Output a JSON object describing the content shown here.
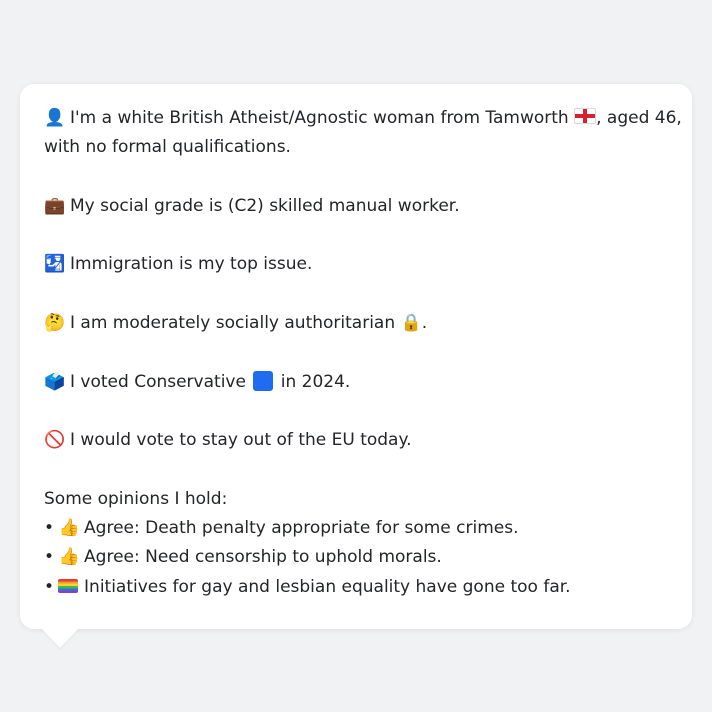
{
  "profile": {
    "line1_icon": "👤",
    "line1_text_a": "I'm a white British Atheist/Agnostic woman from Tamworth ",
    "line1_text_b": ", aged 46,",
    "line2_text": "with no formal qualifications.",
    "social_icon": "💼",
    "social_text": "My social grade is (C2) skilled manual worker.",
    "issue_icon": "🛂",
    "issue_text": "Immigration is my top issue.",
    "stance_icon": "🤔",
    "stance_text": "I am moderately socially authoritarian ",
    "stance_lock_icon": "🔒",
    "stance_end": ".",
    "vote_icon": "🗳️",
    "vote_text_a": "I voted Conservative ",
    "vote_text_b": " in 2024.",
    "eu_icon": "🚫",
    "eu_text": "I would vote to stay out of the EU today."
  },
  "opinions": {
    "heading": "Some opinions I hold:",
    "bullet": "•",
    "items": [
      {
        "icon": "👍",
        "text": "Agree: Death penalty appropriate for some crimes."
      },
      {
        "icon": "👍",
        "text": "Agree: Need censorship to uphold morals."
      },
      {
        "icon": "🏳️‍🌈",
        "text": "Initiatives for gay and lesbian equality have gone too far."
      }
    ]
  },
  "colors": {
    "page_background": "#f1f2f4",
    "bubble_background": "#ffffff",
    "text": "#23252b",
    "conservative_blue": "#1f6cf0",
    "england_red": "#d8202f"
  },
  "icons": {
    "flag": "england-flag-icon",
    "party_color": "blue-square-icon",
    "pride": "rainbow-flag-icon"
  }
}
